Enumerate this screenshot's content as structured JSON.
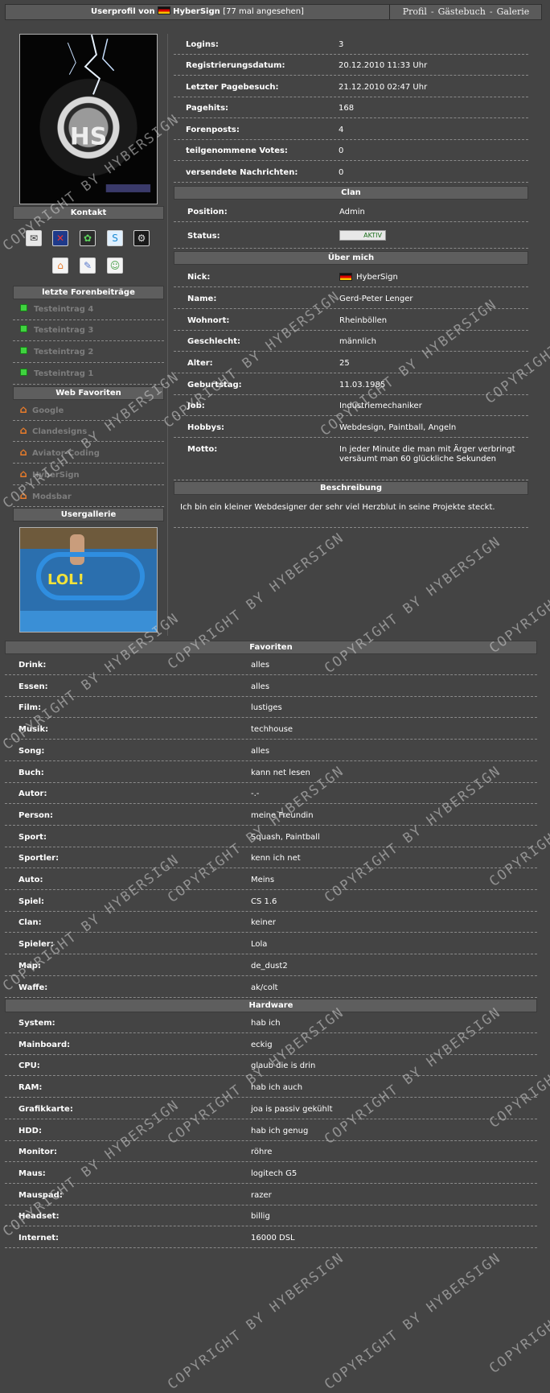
{
  "header": {
    "title_prefix": "Userprofil von",
    "username": "HyberSign",
    "views": "[77 mal angesehen]",
    "nav": [
      "Profil",
      "Gästebuch",
      "Galerie"
    ],
    "nav_separator": "-"
  },
  "sidebar": {
    "kontakt_title": "Kontakt",
    "contact_icons": [
      "mail-icon",
      "xfire-icon",
      "icq-icon",
      "skype-icon",
      "steam-icon",
      "home-icon",
      "contact-card-icon",
      "add-buddy-icon"
    ],
    "forum_title": "letzte Forenbeiträge",
    "forum_posts": [
      "Testeintrag 4",
      "Testeintrag 3",
      "Testeintrag 2",
      "Testeintrag 1"
    ],
    "web_title": "Web Favoriten",
    "web_links": [
      "Google",
      "Clandesigns",
      "Aviator-Coding",
      "HyberSign",
      "Modsbar"
    ],
    "gallery_title": "Usergallerie",
    "gallery_image_text": "LOL!"
  },
  "stats": [
    {
      "label": "Logins:",
      "value": "3"
    },
    {
      "label": "Registrierungsdatum:",
      "value": "20.12.2010 11:33 Uhr"
    },
    {
      "label": "Letzter Pagebesuch:",
      "value": "21.12.2010 02:47 Uhr"
    },
    {
      "label": "Pagehits:",
      "value": "168"
    },
    {
      "label": "Forenposts:",
      "value": "4"
    },
    {
      "label": "teilgenommene Votes:",
      "value": "0"
    },
    {
      "label": "versendete Nachrichten:",
      "value": "0"
    }
  ],
  "clan": {
    "title": "Clan",
    "position_label": "Position:",
    "position_value": "Admin",
    "status_label": "Status:",
    "status_badge": "AKTIV"
  },
  "about": {
    "title": "Über mich",
    "rows": [
      {
        "label": "Nick:",
        "value": "HyberSign"
      },
      {
        "label": "Name:",
        "value": "Gerd-Peter Lenger"
      },
      {
        "label": "Wohnort:",
        "value": "Rheinböllen"
      },
      {
        "label": "Geschlecht:",
        "value": "männlich"
      },
      {
        "label": "Alter:",
        "value": "25"
      },
      {
        "label": "Geburtstag:",
        "value": "11.03.1985"
      },
      {
        "label": "Job:",
        "value": "Industriemechaniker"
      },
      {
        "label": "Hobbys:",
        "value": "Webdesign, Paintball, Angeln"
      },
      {
        "label": "Motto:",
        "value": "In jeder Minute die man mit Ärger verbringt versäumt man 60 glückliche Sekunden"
      }
    ]
  },
  "beschreibung": {
    "title": "Beschreibung",
    "text": "Ich bin ein kleiner Webdesigner der sehr viel Herzblut in seine Projekte steckt."
  },
  "favoriten": {
    "title": "Favoriten",
    "rows": [
      {
        "label": "Drink:",
        "value": "alles"
      },
      {
        "label": "Essen:",
        "value": "alles"
      },
      {
        "label": "Film:",
        "value": "lustiges"
      },
      {
        "label": "Musik:",
        "value": "techhouse"
      },
      {
        "label": "Song:",
        "value": "alles"
      },
      {
        "label": "Buch:",
        "value": "kann net lesen"
      },
      {
        "label": "Autor:",
        "value": "-.-"
      },
      {
        "label": "Person:",
        "value": "meine Freundin"
      },
      {
        "label": "Sport:",
        "value": "Squash, Paintball"
      },
      {
        "label": "Sportler:",
        "value": "kenn ich net"
      },
      {
        "label": "Auto:",
        "value": "Meins"
      },
      {
        "label": "Spiel:",
        "value": "CS 1.6"
      },
      {
        "label": "Clan:",
        "value": "keiner"
      },
      {
        "label": "Spieler:",
        "value": "Lola"
      },
      {
        "label": "Map:",
        "value": "de_dust2"
      },
      {
        "label": "Waffe:",
        "value": "ak/colt"
      }
    ]
  },
  "hardware": {
    "title": "Hardware",
    "rows": [
      {
        "label": "System:",
        "value": "hab ich"
      },
      {
        "label": "Mainboard:",
        "value": "eckig"
      },
      {
        "label": "CPU:",
        "value": "glaub die is drin"
      },
      {
        "label": "RAM:",
        "value": "hab ich auch"
      },
      {
        "label": "Grafikkarte:",
        "value": "joa is passiv gekühlt"
      },
      {
        "label": "HDD:",
        "value": "hab ich genug"
      },
      {
        "label": "Monitor:",
        "value": "röhre"
      },
      {
        "label": "Maus:",
        "value": "logitech G5"
      },
      {
        "label": "Mauspad:",
        "value": "razer"
      },
      {
        "label": "Headset:",
        "value": "billig"
      },
      {
        "label": "Internet:",
        "value": "16000 DSL"
      }
    ]
  },
  "watermark_text": "COPYRIGHT BY HYBERSIGN",
  "colors": {
    "background": "#444444",
    "bar": "#5e5e5e",
    "muted_link": "#7d7d7d",
    "bullet": "#3fd33f"
  }
}
